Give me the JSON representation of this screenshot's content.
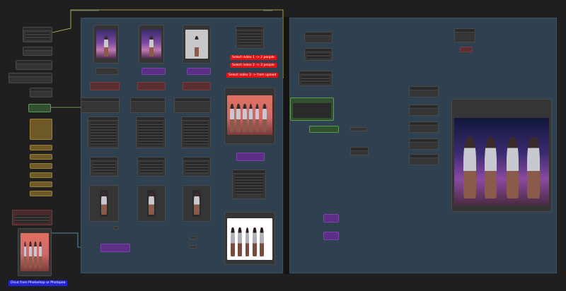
{
  "canvas": {
    "background": "#1f1f1f",
    "group_color": "#2f4150",
    "accent_red": "#e01414",
    "accent_blue": "#2424e0"
  },
  "notes": {
    "index1": "Select index 1 -> 2 people",
    "index2": "Select index 2 -> 3 people",
    "index3": "Select index 3 -> from upload",
    "decut": "Dicut from Photoshop or Photopea"
  }
}
